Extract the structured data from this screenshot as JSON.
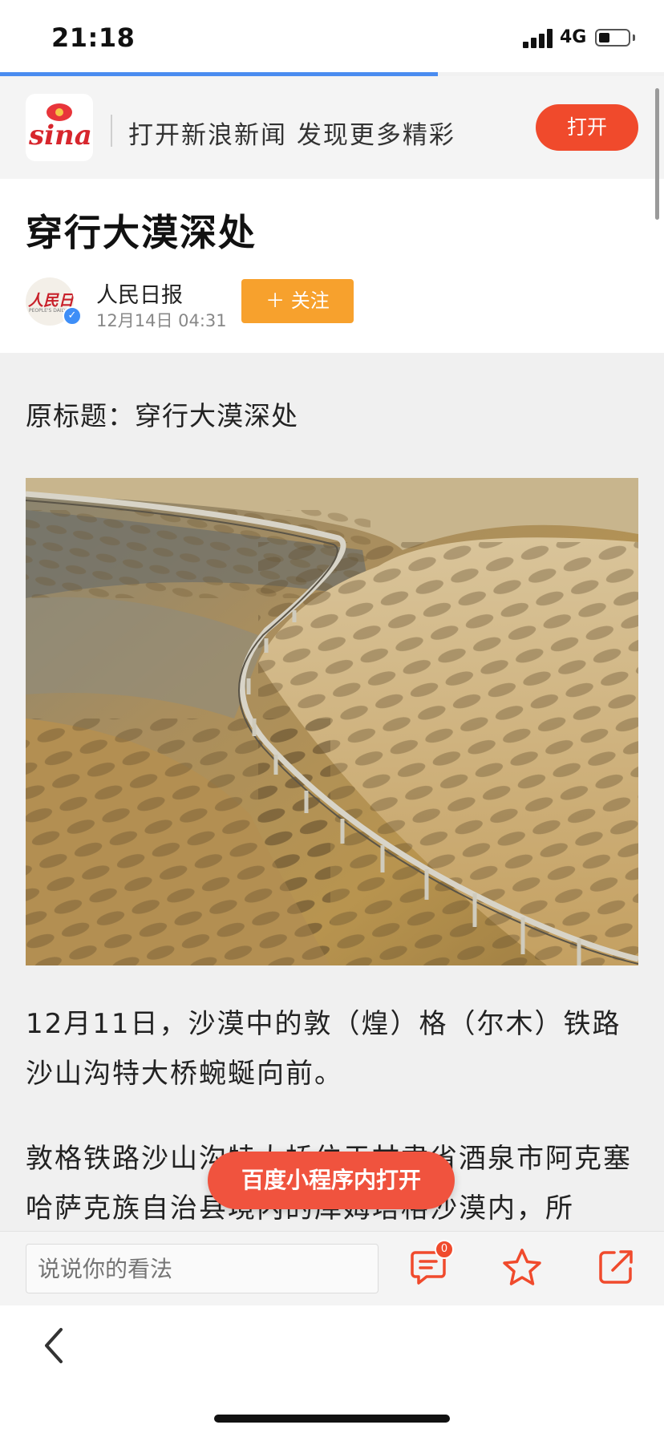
{
  "status_bar": {
    "time": "21:18",
    "network": "4G",
    "battery_level": 0.35
  },
  "load_progress": 0.66,
  "sina_banner": {
    "logo_text": "sina",
    "promo_text": "打开新浪新闻 发现更多精彩",
    "open_label": "打开"
  },
  "article": {
    "title": "穿行大漠深处",
    "author": {
      "name": "人民日报",
      "logo_text": "人民日报",
      "logo_sub": "PEOPLE'S DAILY",
      "time": "12月14日  04:31",
      "verified": true
    },
    "follow_label": "＋ 关注",
    "original_title": "原标题：穿行大漠深处",
    "image_alt": "沙漠中蜿蜒的铁路特大桥",
    "paragraphs": [
      "12月11日，沙漠中的敦（煌）格（尔木）铁路沙山沟特大桥蜿蜒向前。",
      "敦格铁路沙山沟特大桥位于甘肃省酒泉市阿克塞哈萨克族自治县境内的库姆塔格沙漠内，所"
    ]
  },
  "baidu_button": "百度小程序内打开",
  "comment_bar": {
    "placeholder": "说说你的看法",
    "comment_count": "0"
  },
  "icons": [
    "comment-icon",
    "star-icon",
    "share-icon",
    "back-chevron-icon"
  ],
  "colors": {
    "accent_red": "#f04a2c",
    "follow_orange": "#f7a12d",
    "progress_blue": "#4a8cf0"
  }
}
